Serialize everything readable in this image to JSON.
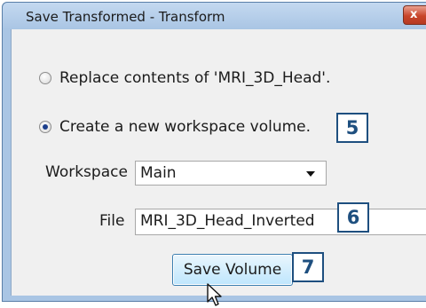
{
  "window": {
    "title": "Save Transformed - Transform",
    "close_icon": "close-icon"
  },
  "options": [
    {
      "label": "Replace contents of 'MRI_3D_Head'.",
      "selected": false
    },
    {
      "label": "Create a new workspace volume.",
      "selected": true
    }
  ],
  "workspace": {
    "label": "Workspace",
    "value": "Main",
    "dropdown_icon": "chevron-down-icon"
  },
  "file": {
    "label": "File",
    "value": "MRI_3D_Head_Inverted"
  },
  "save_button": {
    "label": "Save Volume"
  },
  "callouts": [
    "5",
    "6",
    "7"
  ],
  "colors": {
    "callout": "#1e4f7f",
    "titlebar": "#a9c5e4",
    "button_border": "#3c7fb1",
    "close_button": "#c8452b"
  }
}
